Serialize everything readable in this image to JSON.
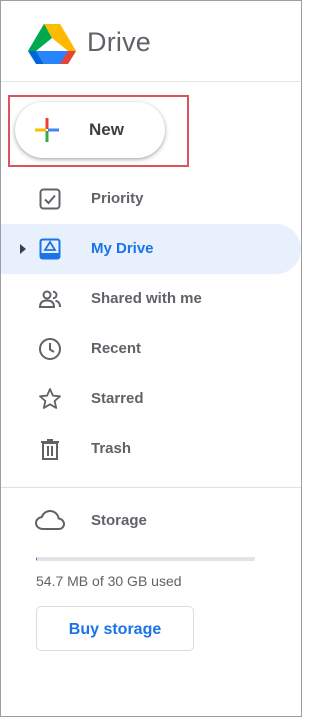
{
  "app": {
    "title": "Drive"
  },
  "new_button": {
    "label": "New"
  },
  "nav": {
    "items": [
      {
        "label": "Priority",
        "icon": "priority-checkbox-icon",
        "active": false
      },
      {
        "label": "My Drive",
        "icon": "my-drive-icon",
        "active": true
      },
      {
        "label": "Shared with me",
        "icon": "people-icon",
        "active": false
      },
      {
        "label": "Recent",
        "icon": "clock-icon",
        "active": false
      },
      {
        "label": "Starred",
        "icon": "star-icon",
        "active": false
      },
      {
        "label": "Trash",
        "icon": "trash-icon",
        "active": false
      }
    ]
  },
  "storage": {
    "label": "Storage",
    "icon": "cloud-icon",
    "usage_text": "54.7 MB of 30 GB used",
    "used_fraction": 0.0018,
    "buy_label": "Buy storage"
  },
  "colors": {
    "accent": "#1a73e8",
    "active_bg": "#e8f0fe",
    "text_secondary": "#5f6368",
    "highlight_border": "#d9545c"
  }
}
